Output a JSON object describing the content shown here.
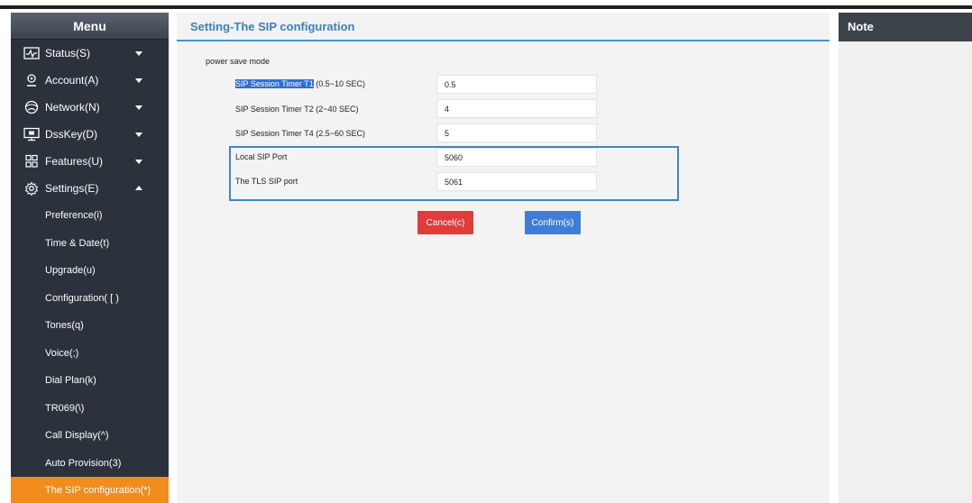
{
  "sidebar": {
    "title": "Menu",
    "items": [
      {
        "label": "Status(S)",
        "icon": "status-icon",
        "expanded": false
      },
      {
        "label": "Account(A)",
        "icon": "account-icon",
        "expanded": false
      },
      {
        "label": "Network(N)",
        "icon": "network-icon",
        "expanded": false
      },
      {
        "label": "DssKey(D)",
        "icon": "dsskey-icon",
        "expanded": false
      },
      {
        "label": "Features(U)",
        "icon": "features-icon",
        "expanded": false
      },
      {
        "label": "Settings(E)",
        "icon": "settings-icon",
        "expanded": true
      }
    ],
    "sub_items": [
      "Preference(i)",
      "Time & Date(t)",
      "Upgrade(u)",
      "Configuration( [ )",
      "Tones(q)",
      "Voice(;)",
      "Dial Plan(k)",
      "TR069(\\)",
      "Call Display(^)",
      "Auto Provision(3)",
      "The SIP configuration(*)"
    ],
    "active_sub_item": "The SIP configuration(*)"
  },
  "main": {
    "title": "Setting-The SIP configuration",
    "section": "power save mode",
    "rows": [
      {
        "label_highlight": "SIP Session Timer T1",
        "label_rest": " (0.5~10 SEC)",
        "value": "0.5"
      },
      {
        "label": "SIP Session Timer T2 (2~40 SEC)",
        "value": "4"
      },
      {
        "label": "SIP Session Timer T4 (2.5~60 SEC)",
        "value": "5"
      },
      {
        "label": "Local SIP Port",
        "value": "5060"
      },
      {
        "label": "The TLS SIP port",
        "value": "5061"
      }
    ],
    "cancel_label": "Cancel(c)",
    "confirm_label": "Confirm(s)"
  },
  "note": {
    "title": "Note"
  },
  "colors": {
    "sidebar_bg": "#2b323c",
    "active_item": "#f28c1c",
    "title_blue": "#3b7fbf",
    "cancel": "#e23b3b",
    "confirm": "#3f7ed6"
  }
}
